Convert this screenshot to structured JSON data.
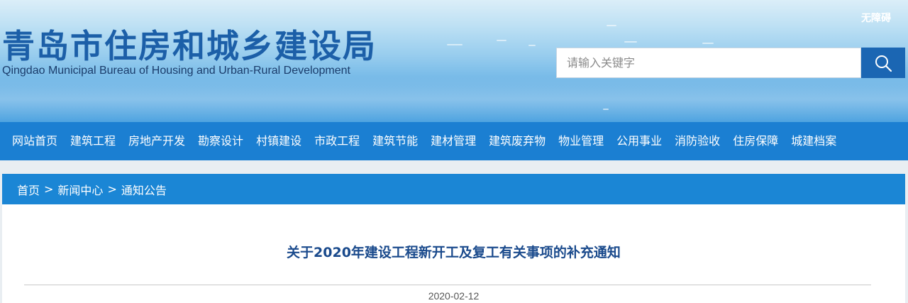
{
  "header": {
    "title_cn": "青岛市住房和城乡建设局",
    "title_en": "Qingdao Municipal Bureau of Housing and Urban-Rural Development",
    "accessibility_label": "无障碍",
    "search": {
      "placeholder": "请输入关键字",
      "button_icon": "search-icon"
    }
  },
  "nav": {
    "items": [
      {
        "label": "网站首页"
      },
      {
        "label": "建筑工程"
      },
      {
        "label": "房地产开发"
      },
      {
        "label": "勘察设计"
      },
      {
        "label": "村镇建设"
      },
      {
        "label": "市政工程"
      },
      {
        "label": "建筑节能"
      },
      {
        "label": "建材管理"
      },
      {
        "label": "建筑废弃物"
      },
      {
        "label": "物业管理"
      },
      {
        "label": "公用事业"
      },
      {
        "label": "消防验收"
      },
      {
        "label": "住房保障"
      },
      {
        "label": "城建档案"
      }
    ]
  },
  "breadcrumb": {
    "items": [
      "首页",
      "新闻中心",
      "通知公告"
    ],
    "separator": ">"
  },
  "article": {
    "title": "关于2020年建设工程新开工及复工有关事项的补充通知",
    "date": "2020-02-12"
  },
  "colors": {
    "nav_bg": "#1b7fd2",
    "breadcrumb_bg": "#1b86d5",
    "title_blue": "#1c5fa8",
    "search_button": "#1b66b3"
  }
}
